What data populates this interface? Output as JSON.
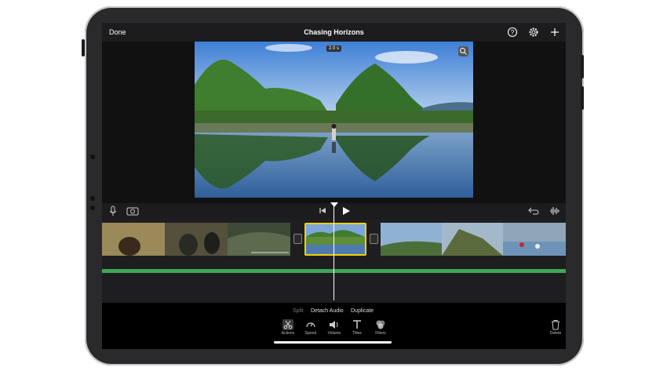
{
  "header": {
    "done_label": "Done",
    "project_title": "Chasing Horizons",
    "help_icon": "question-circle-icon",
    "settings_icon": "gear-icon",
    "add_icon": "plus-icon"
  },
  "viewer": {
    "timecode": "2.0 s",
    "zoom_icon": "magnify-icon"
  },
  "controls": {
    "mic_icon": "microphone-icon",
    "camera_icon": "camera-icon",
    "rewind_icon": "skip-back-icon",
    "play_icon": "play-icon",
    "undo_icon": "undo-icon",
    "audio_icon": "waveform-icon"
  },
  "context_actions": {
    "split": "Split",
    "detach_audio": "Detach Audio",
    "duplicate": "Duplicate"
  },
  "tools": [
    {
      "label": "Actions",
      "icon": "scissors-icon"
    },
    {
      "label": "Speed",
      "icon": "speedometer-icon"
    },
    {
      "label": "Volume",
      "icon": "speaker-icon"
    },
    {
      "label": "Titles",
      "icon": "titles-icon"
    },
    {
      "label": "Filters",
      "icon": "filters-icon"
    }
  ],
  "delete_label": "Delete",
  "colors": {
    "selection": "#f2d100",
    "audio_track": "#3fa65a"
  }
}
